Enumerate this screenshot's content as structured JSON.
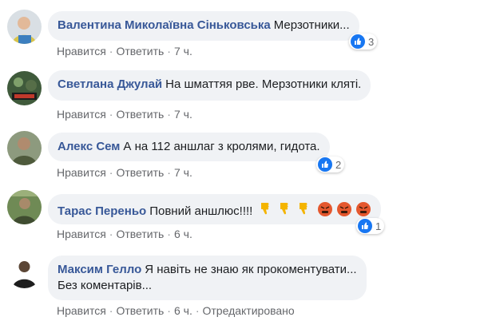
{
  "colors": {
    "bubble_bg": "#f0f2f5",
    "name": "#385898",
    "meta": "#65676b",
    "like_blue": "#1877f2"
  },
  "comments": [
    {
      "author": "Валентина Миколаївна Сіньковська",
      "text": "Мерзотники...",
      "actions": {
        "like": "Нравится",
        "reply": "Ответить",
        "time": "7 ч."
      },
      "reactions": {
        "icon": "like-icon",
        "count": "3"
      }
    },
    {
      "author": "Светлана Джулай",
      "text": "На шматтяя рве. Мерзотники кляті.",
      "actions": {
        "like": "Нравится",
        "reply": "Ответить",
        "time": "7 ч."
      }
    },
    {
      "author": "Алекс Сем",
      "text": "А на 112 аншлаг з кролями, гидота.",
      "actions": {
        "like": "Нравится",
        "reply": "Ответить",
        "time": "7 ч."
      },
      "reactions": {
        "icon": "like-icon",
        "count": "2"
      }
    },
    {
      "author": "Тарас Переньо",
      "text": "Повний аншлюс!!!!",
      "emojis": [
        "thumbs-down",
        "thumbs-down",
        "thumbs-down",
        "angry-face",
        "angry-face",
        "angry-face"
      ],
      "actions": {
        "like": "Нравится",
        "reply": "Ответить",
        "time": "6 ч."
      },
      "reactions": {
        "icon": "like-icon",
        "count": "1"
      }
    },
    {
      "author": "Максим Гелло",
      "text_line1": "Я навіть не знаю як прокоментувати...",
      "text_line2": "Без коментарів...",
      "actions": {
        "like": "Нравится",
        "reply": "Ответить",
        "time": "6 ч.",
        "edited": "Отредактировано"
      }
    }
  ]
}
